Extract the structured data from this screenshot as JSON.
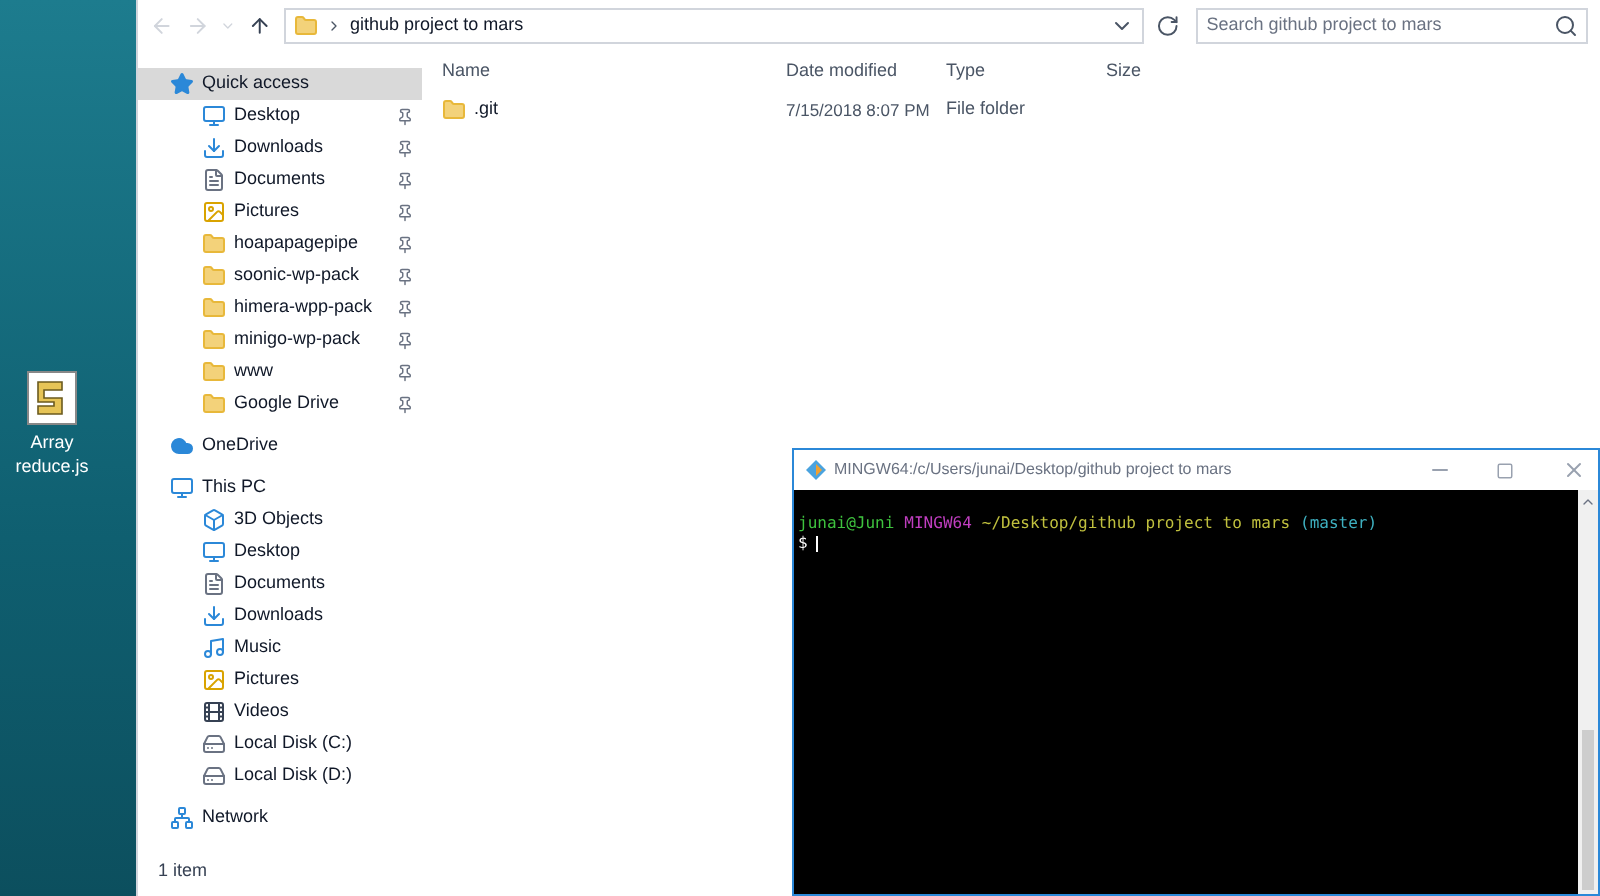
{
  "desktop": {
    "icons": [
      {
        "label": "Array reduce.js"
      }
    ]
  },
  "explorer": {
    "address": "github project to mars",
    "search": {
      "placeholder": "Search github project to mars"
    },
    "sidebar": [
      {
        "label": "Quick access",
        "kind": "quick",
        "selected": true,
        "children": [
          {
            "label": "Desktop",
            "kind": "desktop",
            "pinned": true
          },
          {
            "label": "Downloads",
            "kind": "downloads",
            "pinned": true
          },
          {
            "label": "Documents",
            "kind": "documents",
            "pinned": true
          },
          {
            "label": "Pictures",
            "kind": "pictures",
            "pinned": true
          },
          {
            "label": "hoapapagepipe",
            "kind": "folder",
            "pinned": true
          },
          {
            "label": "soonic-wp-pack",
            "kind": "folder",
            "pinned": true
          },
          {
            "label": "himera-wpp-pack",
            "kind": "folder",
            "pinned": true
          },
          {
            "label": "minigo-wp-pack",
            "kind": "folder",
            "pinned": true
          },
          {
            "label": "www",
            "kind": "folder",
            "pinned": true
          },
          {
            "label": "Google Drive",
            "kind": "drive",
            "pinned": true
          }
        ]
      },
      {
        "label": "OneDrive",
        "kind": "cloud",
        "selected": false
      },
      {
        "label": "This PC",
        "kind": "pc",
        "selected": false,
        "children": [
          {
            "label": "3D Objects",
            "kind": "objects",
            "pinned": false
          },
          {
            "label": "Desktop",
            "kind": "desktop",
            "pinned": false
          },
          {
            "label": "Documents",
            "kind": "documents",
            "pinned": false
          },
          {
            "label": "Downloads",
            "kind": "downloads",
            "pinned": false
          },
          {
            "label": "Music",
            "kind": "music",
            "pinned": false
          },
          {
            "label": "Pictures",
            "kind": "pictures",
            "pinned": false
          },
          {
            "label": "Videos",
            "kind": "videos",
            "pinned": false
          },
          {
            "label": "Local Disk (C:)",
            "kind": "disk",
            "pinned": false
          },
          {
            "label": "Local Disk (D:)",
            "kind": "disk",
            "pinned": false
          }
        ]
      },
      {
        "label": "Network",
        "kind": "network",
        "selected": false
      }
    ],
    "table": {
      "columns": [
        "Name",
        "Date modified",
        "Type",
        "Size"
      ],
      "rows": [
        {
          "name": ".git",
          "date_modified": "7/15/2018 8:07 PM",
          "type": "File folder"
        }
      ]
    },
    "status_bar": "1 item"
  },
  "terminal": {
    "title": "MINGW64:/c/Users/junai/Desktop/github project to mars",
    "prompt": [
      {
        "text": "junai@Juni",
        "color": "#3ec23e"
      },
      {
        "text": "MINGW64",
        "color": "#c03ec0"
      },
      {
        "text": "~/Desktop/github project to mars",
        "color": "#c0c03e"
      },
      {
        "text": "(master)",
        "color": "#3eb0c0"
      }
    ],
    "input_line": "$"
  }
}
